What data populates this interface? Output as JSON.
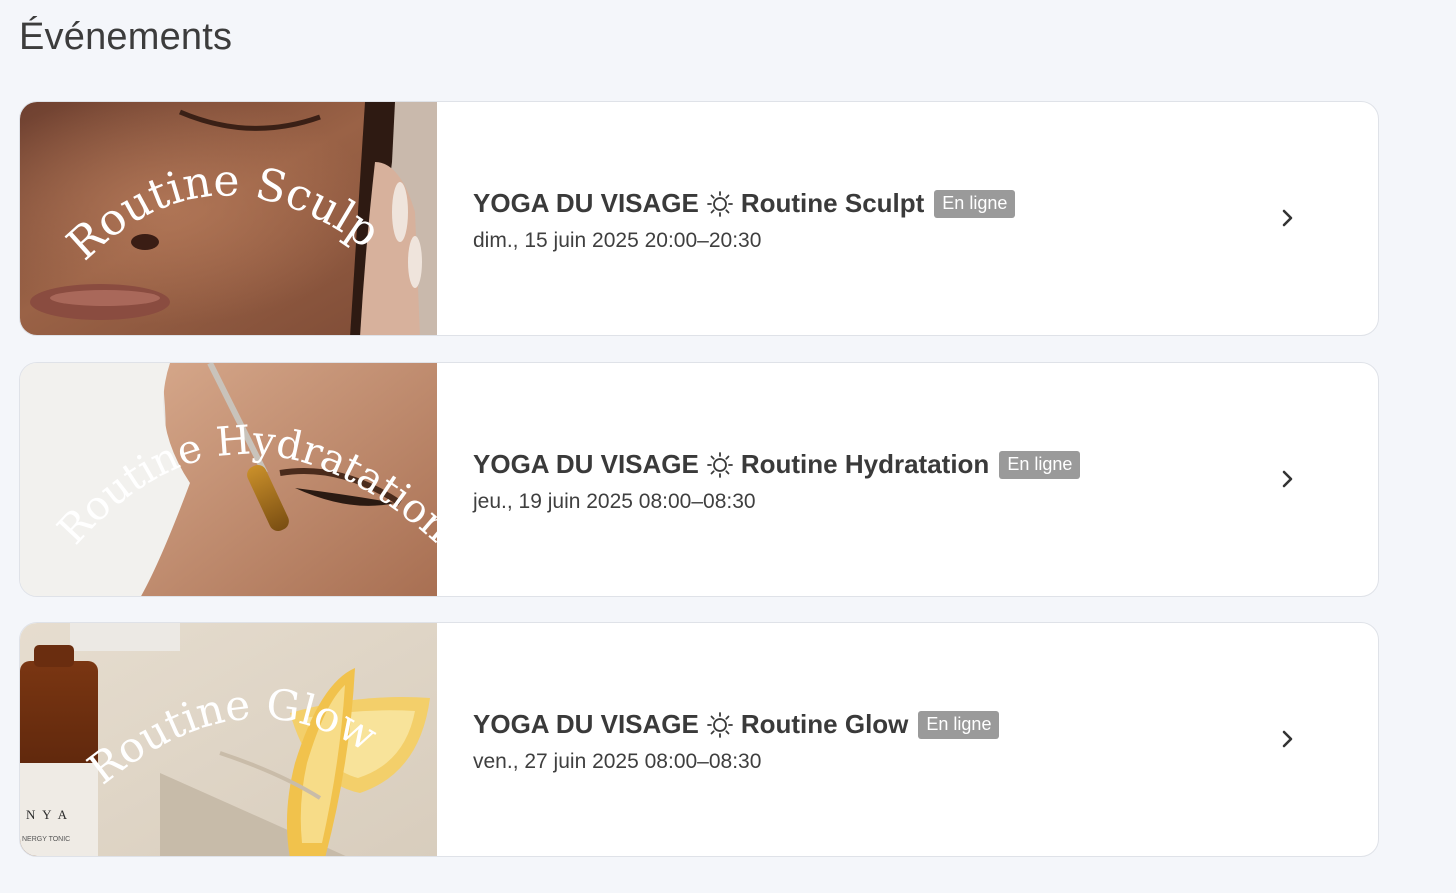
{
  "page": {
    "title": "Événements"
  },
  "events": [
    {
      "image_caption": "Routine Sculpt",
      "series": "YOGA DU VISAGE",
      "name": "Routine Sculpt",
      "badge": "En ligne",
      "date": "dim., 15 juin 2025 20:00–20:30"
    },
    {
      "image_caption": "Routine Hydratation",
      "series": "YOGA DU VISAGE",
      "name": "Routine Hydratation",
      "badge": "En ligne",
      "date": "jeu., 19 juin 2025 08:00–08:30"
    },
    {
      "image_caption": "Routine Glow",
      "series": "YOGA DU VISAGE",
      "name": "Routine Glow",
      "badge": "En ligne",
      "date": "ven., 27 juin 2025 08:00–08:30",
      "product_label": "N Y A",
      "product_sublabel": "NERGY TONIC"
    }
  ],
  "icons": {
    "separator": "sun-icon",
    "open": "chevron-right-icon"
  },
  "colors": {
    "background": "#f4f6fa",
    "card": "#ffffff",
    "badge": "#9a9a9a",
    "text": "#3a3a3a"
  }
}
